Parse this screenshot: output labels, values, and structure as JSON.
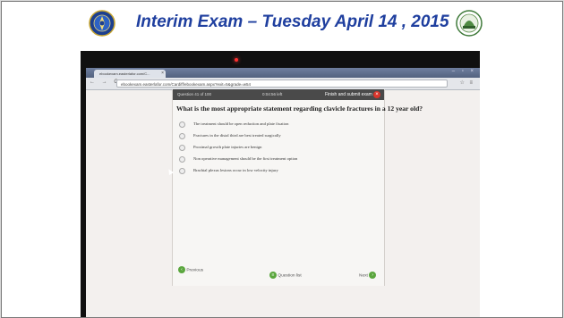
{
  "slide": {
    "title": "Interim Exam – Tuesday April 14 , 2015",
    "logo_left_icon": "university-seal-icon",
    "logo_right_icon": "faculty-emblem-icon",
    "title_color": "#1f3f9f"
  },
  "browser": {
    "tab_title": "ebookexam.easterlafor.com/C...",
    "tab_close": "×",
    "window_controls": "– ▫ ×",
    "nav_buttons": "← → C",
    "url": "ebookexam.easterlafor.com/Cardiff/ebookexam.aspx?exit=5&grade=w54",
    "toolbar_icons": "☆ ≡"
  },
  "exam": {
    "question_counter": "Question 41 of 100",
    "timer": "0:04:56 left",
    "finish_label": "Finish and submit exam",
    "finish_icon": "close-icon",
    "question": "What is the most appropriate statement regarding clavicle fractures in a 12 year old?",
    "options": [
      "The treatment should be open reduction and plate fixation",
      "Fractures in the distal third are best treated surgically",
      "Proximal growth plate injuries are benign",
      "Non operative management should be the first treatment option",
      "Brachial plexus lesions occur in low velocity injury"
    ],
    "previous_label": "Previous",
    "question_list_label": "Question list",
    "next_label": "Next"
  }
}
